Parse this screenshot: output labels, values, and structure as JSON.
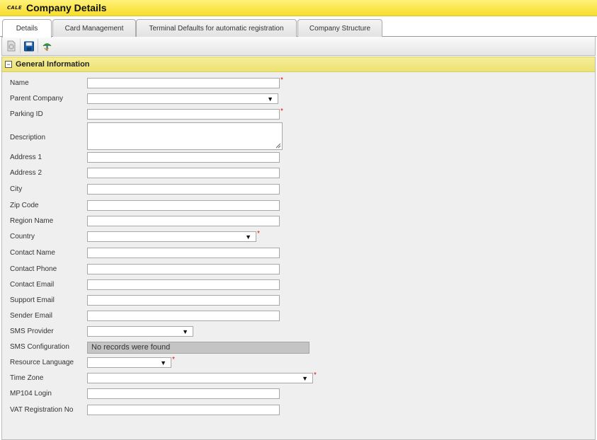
{
  "header": {
    "logo": "CALE",
    "title": "Company Details"
  },
  "tabs": [
    {
      "label": "Details",
      "active": true
    },
    {
      "label": "Card Management",
      "active": false
    },
    {
      "label": "Terminal Defaults for automatic registration",
      "active": false
    },
    {
      "label": "Company Structure",
      "active": false
    }
  ],
  "section": {
    "title": "General Information",
    "collapse_symbol": "−"
  },
  "fields": {
    "name": {
      "label": "Name",
      "value": ""
    },
    "parent_company": {
      "label": "Parent Company",
      "value": ""
    },
    "parking_id": {
      "label": "Parking ID",
      "value": ""
    },
    "description": {
      "label": "Description",
      "value": ""
    },
    "address1": {
      "label": "Address 1",
      "value": ""
    },
    "address2": {
      "label": "Address 2",
      "value": ""
    },
    "city": {
      "label": "City",
      "value": ""
    },
    "zip": {
      "label": "Zip Code",
      "value": ""
    },
    "region": {
      "label": "Region Name",
      "value": ""
    },
    "country": {
      "label": "Country",
      "value": ""
    },
    "contact_name": {
      "label": "Contact Name",
      "value": ""
    },
    "contact_phone": {
      "label": "Contact Phone",
      "value": ""
    },
    "contact_email": {
      "label": "Contact Email",
      "value": ""
    },
    "support_email": {
      "label": "Support Email",
      "value": ""
    },
    "sender_email": {
      "label": "Sender Email",
      "value": ""
    },
    "sms_provider": {
      "label": "SMS Provider",
      "value": ""
    },
    "sms_config": {
      "label": "SMS Configuration",
      "empty_text": "No records were found"
    },
    "resource_language": {
      "label": "Resource Language",
      "value": ""
    },
    "time_zone": {
      "label": "Time Zone",
      "value": ""
    },
    "mp104_login": {
      "label": "MP104 Login",
      "value": ""
    },
    "vat": {
      "label": "VAT Registration No",
      "value": ""
    }
  },
  "required_marker": "*",
  "dropdown_arrow": "▼",
  "colors": {
    "title_bar": "#f7dd2a",
    "section_bar": "#ece272",
    "required": "#e01010"
  }
}
